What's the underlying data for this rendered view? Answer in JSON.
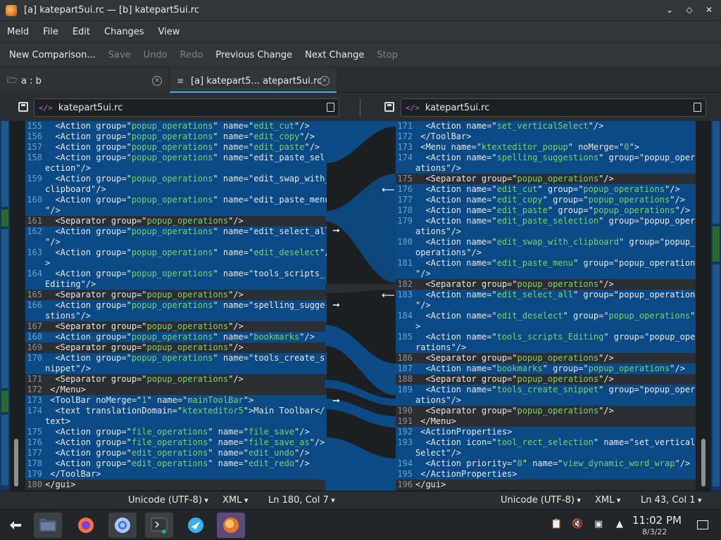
{
  "window": {
    "title": "[a] katepart5ui.rc — [b] katepart5ui.rc"
  },
  "menu": [
    "Meld",
    "File",
    "Edit",
    "Changes",
    "View"
  ],
  "toolbar": {
    "new_comparison": "New Comparison...",
    "save": "Save",
    "undo": "Undo",
    "redo": "Redo",
    "previous_change": "Previous Change",
    "next_change": "Next Change",
    "stop": "Stop"
  },
  "tabs": [
    {
      "label": "a : b"
    },
    {
      "label": "[a] katepart5... atepart5ui.rc"
    }
  ],
  "files": {
    "left": "katepart5ui.rc",
    "right": "katepart5ui.rc"
  },
  "left_lines": [
    {
      "n": "155",
      "t": "  <Action group=\"popup_operations\" name=\"edit_cut\"/>",
      "k": "c"
    },
    {
      "n": "156",
      "t": "  <Action group=\"popup_operations\" name=\"edit_copy\"/>",
      "k": "c"
    },
    {
      "n": "157",
      "t": "  <Action group=\"popup_operations\" name=\"edit_paste\"/>",
      "k": "c"
    },
    {
      "n": "158",
      "t": "  <Action group=\"popup_operations\" name=\"edit_paste_sel-",
      "k": "c"
    },
    {
      "n": "",
      "t": "ection\"/>",
      "k": "c"
    },
    {
      "n": "159",
      "t": "  <Action group=\"popup_operations\" name=\"edit_swap_with_",
      "k": "c"
    },
    {
      "n": "",
      "t": "clipboard\"/>",
      "k": "c"
    },
    {
      "n": "160",
      "t": "  <Action group=\"popup_operations\" name=\"edit_paste_menu",
      "k": "c"
    },
    {
      "n": "",
      "t": "\"/>",
      "k": "c"
    },
    {
      "n": "161",
      "t": "  <Separator group=\"popup_operations\"/>",
      "k": "s"
    },
    {
      "n": "162",
      "t": "  <Action group=\"popup_operations\" name=\"edit_select_all",
      "k": "c"
    },
    {
      "n": "",
      "t": "\"/>",
      "k": "c"
    },
    {
      "n": "163",
      "t": "  <Action group=\"popup_operations\" name=\"edit_deselect\"/",
      "k": "c"
    },
    {
      "n": "",
      "t": ">",
      "k": "c"
    },
    {
      "n": "164",
      "t": "  <Action group=\"popup_operations\" name=\"tools_scripts_",
      "k": "c"
    },
    {
      "n": "",
      "t": "Editing\"/>",
      "k": "c"
    },
    {
      "n": "165",
      "t": "  <Separator group=\"popup_operations\"/>",
      "k": "s"
    },
    {
      "n": "166",
      "t": "  <Action group=\"popup_operations\" name=\"spelling_sugge-",
      "k": "c"
    },
    {
      "n": "",
      "t": "stions\"/>",
      "k": "c"
    },
    {
      "n": "167",
      "t": "  <Separator group=\"popup_operations\"/>",
      "k": "s"
    },
    {
      "n": "168",
      "t": "  <Action group=\"popup_operations\" name=\"bookmarks\"/>",
      "k": "c"
    },
    {
      "n": "169",
      "t": "  <Separator group=\"popup_operations\"/>",
      "k": "s"
    },
    {
      "n": "170",
      "t": "  <Action group=\"popup_operations\" name=\"tools_create_s-",
      "k": "c"
    },
    {
      "n": "",
      "t": "nippet\"/>",
      "k": "c"
    },
    {
      "n": "171",
      "t": "  <Separator group=\"popup_operations\"/>",
      "k": "s"
    },
    {
      "n": "172",
      "t": " </Menu>",
      "k": "s"
    },
    {
      "n": "173",
      "t": " <ToolBar noMerge=\"1\" name=\"mainToolBar\">",
      "k": "c"
    },
    {
      "n": "174",
      "t": "  <text translationDomain=\"ktexteditor5\">Main Toolbar</",
      "k": "c"
    },
    {
      "n": "",
      "t": "text>",
      "k": "c"
    },
    {
      "n": "175",
      "t": "  <Action group=\"file_operations\" name=\"file_save\"/>",
      "k": "c"
    },
    {
      "n": "176",
      "t": "  <Action group=\"file_operations\" name=\"file_save_as\"/>",
      "k": "c"
    },
    {
      "n": "177",
      "t": "  <Action group=\"edit_operations\" name=\"edit_undo\"/>",
      "k": "c"
    },
    {
      "n": "178",
      "t": "  <Action group=\"edit_operations\" name=\"edit_redo\"/>",
      "k": "c"
    },
    {
      "n": "179",
      "t": " </ToolBar>",
      "k": "c"
    },
    {
      "n": "180",
      "t": "</gui>",
      "k": "s"
    }
  ],
  "right_lines": [
    {
      "n": "171",
      "t": "  <Action name=\"set_verticalSelect\"/>",
      "k": "c"
    },
    {
      "n": "172",
      "t": " </ToolBar>",
      "k": "c"
    },
    {
      "n": "173",
      "t": " <Menu name=\"ktexteditor_popup\" noMerge=\"0\">",
      "k": "c"
    },
    {
      "n": "174",
      "t": "  <Action name=\"spelling_suggestions\" group=\"popup_oper-",
      "k": "c"
    },
    {
      "n": "",
      "t": "ations\"/>",
      "k": "c"
    },
    {
      "n": "175",
      "t": "  <Separator group=\"popup_operations\"/>",
      "k": "s"
    },
    {
      "n": "176",
      "t": "  <Action name=\"edit_cut\" group=\"popup_operations\"/>",
      "k": "c"
    },
    {
      "n": "177",
      "t": "  <Action name=\"edit_copy\" group=\"popup_operations\"/>",
      "k": "c"
    },
    {
      "n": "178",
      "t": "  <Action name=\"edit_paste\" group=\"popup_operations\"/>",
      "k": "c"
    },
    {
      "n": "179",
      "t": "  <Action name=\"edit_paste_selection\" group=\"popup_oper-",
      "k": "c"
    },
    {
      "n": "",
      "t": "ations\"/>",
      "k": "c"
    },
    {
      "n": "180",
      "t": "  <Action name=\"edit_swap_with_clipboard\" group=\"popup_",
      "k": "c"
    },
    {
      "n": "",
      "t": "operations\"/>",
      "k": "c"
    },
    {
      "n": "181",
      "t": "  <Action name=\"edit_paste_menu\" group=\"popup_operations",
      "k": "c"
    },
    {
      "n": "",
      "t": "\"/>",
      "k": "c"
    },
    {
      "n": "182",
      "t": "  <Separator group=\"popup_operations\"/>",
      "k": "s"
    },
    {
      "n": "183",
      "t": "  <Action name=\"edit_select_all\" group=\"popup_operations",
      "k": "c"
    },
    {
      "n": "",
      "t": "\"/>",
      "k": "c"
    },
    {
      "n": "184",
      "t": "  <Action name=\"edit_deselect\" group=\"popup_operations\"/",
      "k": "c"
    },
    {
      "n": "",
      "t": ">",
      "k": "c"
    },
    {
      "n": "185",
      "t": "  <Action name=\"tools_scripts_Editing\" group=\"popup_ope-",
      "k": "c"
    },
    {
      "n": "",
      "t": "rations\"/>",
      "k": "c"
    },
    {
      "n": "186",
      "t": "  <Separator group=\"popup_operations\"/>",
      "k": "s"
    },
    {
      "n": "187",
      "t": "  <Action name=\"bookmarks\" group=\"popup_operations\"/>",
      "k": "c"
    },
    {
      "n": "188",
      "t": "  <Separator group=\"popup_operations\"/>",
      "k": "s"
    },
    {
      "n": "189",
      "t": "  <Action name=\"tools_create_snippet\" group=\"popup_oper-",
      "k": "c"
    },
    {
      "n": "",
      "t": "ations\"/>",
      "k": "c"
    },
    {
      "n": "190",
      "t": "  <Separator group=\"popup_operations\"/>",
      "k": "s"
    },
    {
      "n": "191",
      "t": " </Menu>",
      "k": "s"
    },
    {
      "n": "192",
      "t": " <ActionProperties>",
      "k": "c"
    },
    {
      "n": "193",
      "t": "  <Action icon=\"tool_rect_selection\" name=\"set_vertical-",
      "k": "c"
    },
    {
      "n": "",
      "t": "Select\"/>",
      "k": "c"
    },
    {
      "n": "194",
      "t": "  <Action priority=\"0\" name=\"view_dynamic_word_wrap\"/>",
      "k": "c"
    },
    {
      "n": "195",
      "t": " </ActionProperties>",
      "k": "c"
    },
    {
      "n": "196",
      "t": "</gui>",
      "k": "s"
    }
  ],
  "status_left": {
    "encoding": "Unicode (UTF-8)",
    "syntax": "XML",
    "position": "Ln 180, Col 7"
  },
  "status_right": {
    "encoding": "Unicode (UTF-8)",
    "syntax": "XML",
    "position": "Ln 43, Col 1"
  },
  "clock": {
    "time": "11:02 PM",
    "date": "8/3/22"
  },
  "colors": {
    "change": "#0c4a85",
    "accent": "#3daee9",
    "string": "#7ad16a"
  },
  "taskbar_icons": [
    "application-launcher-icon",
    "file-manager-icon",
    "firefox-icon",
    "chromium-icon",
    "terminal-icon",
    "kde-connect-icon",
    "meld-icon"
  ]
}
